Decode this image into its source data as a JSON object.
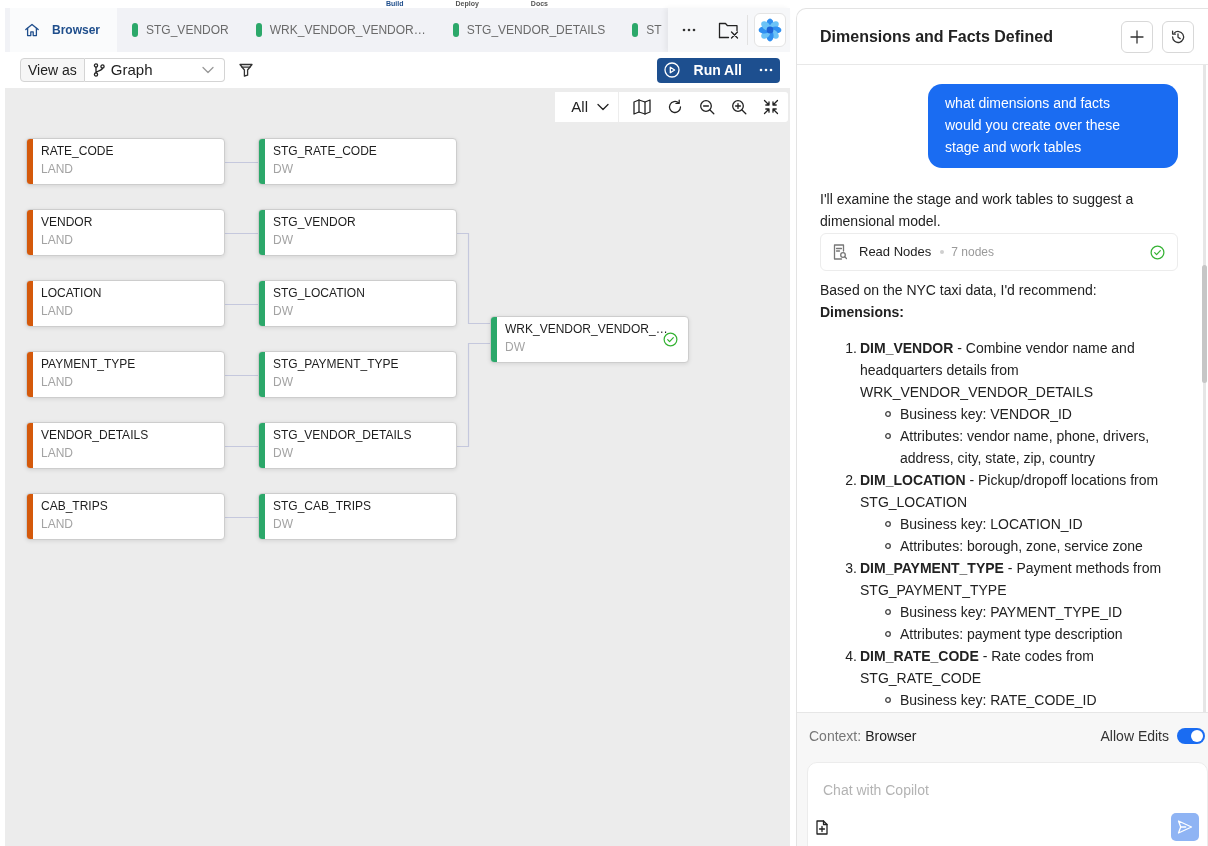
{
  "top_nav": [
    {
      "label": "Build",
      "selected": true
    },
    {
      "label": "Deploy",
      "selected": false
    },
    {
      "label": "Docs",
      "selected": false
    }
  ],
  "tabs": [
    {
      "kind": "home",
      "label": "Browser",
      "selected": true
    },
    {
      "kind": "node",
      "label": "STG_VENDOR",
      "color": "#2ca86a",
      "selected": false
    },
    {
      "kind": "node",
      "label": "WRK_VENDOR_VENDOR…",
      "color": "#2ca86a",
      "selected": false
    },
    {
      "kind": "node",
      "label": "STG_VENDOR_DETAILS",
      "color": "#2ca86a",
      "selected": false
    },
    {
      "kind": "node",
      "label": "ST",
      "color": "#2ca86a",
      "selected": false
    }
  ],
  "toolbar": {
    "view_as_label": "View as",
    "view_mode": "Graph",
    "run_button": "Run All"
  },
  "canvas_controls": {
    "layer_filter": "All"
  },
  "graph": {
    "pairs": [
      {
        "source": {
          "name": "RATE_CODE",
          "layer": "LAND",
          "color": "#d4590b"
        },
        "target": {
          "name": "STG_RATE_CODE",
          "layer": "DW",
          "color": "#2ca86a",
          "feeds_join": false
        }
      },
      {
        "source": {
          "name": "VENDOR",
          "layer": "LAND",
          "color": "#d4590b"
        },
        "target": {
          "name": "STG_VENDOR",
          "layer": "DW",
          "color": "#2ca86a",
          "feeds_join": true
        }
      },
      {
        "source": {
          "name": "LOCATION",
          "layer": "LAND",
          "color": "#d4590b"
        },
        "target": {
          "name": "STG_LOCATION",
          "layer": "DW",
          "color": "#2ca86a",
          "feeds_join": false
        }
      },
      {
        "source": {
          "name": "PAYMENT_TYPE",
          "layer": "LAND",
          "color": "#d4590b"
        },
        "target": {
          "name": "STG_PAYMENT_TYPE",
          "layer": "DW",
          "color": "#2ca86a",
          "feeds_join": false
        }
      },
      {
        "source": {
          "name": "VENDOR_DETAILS",
          "layer": "LAND",
          "color": "#d4590b"
        },
        "target": {
          "name": "STG_VENDOR_DETAILS",
          "layer": "DW",
          "color": "#2ca86a",
          "feeds_join": true
        }
      },
      {
        "source": {
          "name": "CAB_TRIPS",
          "layer": "LAND",
          "color": "#d4590b"
        },
        "target": {
          "name": "STG_CAB_TRIPS",
          "layer": "DW",
          "color": "#2ca86a",
          "feeds_join": false
        }
      }
    ],
    "join": {
      "name": "WRK_VENDOR_VENDOR_…",
      "layer": "DW",
      "color": "#2ca86a",
      "completed": true
    }
  },
  "copilot": {
    "title": "Dimensions and Facts Defined",
    "messages": [
      {
        "kind": "user",
        "text": "what dimensions and facts would you create over these stage and work tables"
      },
      {
        "kind": "assistant",
        "blocks": [
          {
            "kind": "paragraph",
            "text": "I'll examine the stage and work tables to suggest a dimensional model."
          },
          {
            "kind": "tool",
            "label": "Read Nodes",
            "detail": "7 nodes",
            "completed": true
          },
          {
            "kind": "paragraph",
            "text": "Based on the NYC taxi data, I'd recommend:"
          },
          {
            "kind": "heading",
            "text": "Dimensions:"
          },
          {
            "kind": "ordered_list",
            "items": [
              {
                "number": "1.",
                "text": "**DIM_VENDOR** - Combine vendor name and headquarters details from WRK_VENDOR_VENDOR_DETAILS",
                "children": [
                  {
                    "text": "Business key: VENDOR_ID"
                  },
                  {
                    "text": "Attributes: vendor name, phone, drivers, address, city, state, zip, country"
                  }
                ]
              },
              {
                "number": "2.",
                "text": "**DIM_LOCATION** - Pickup/dropoff locations from STG_LOCATION",
                "children": [
                  {
                    "text": "Business key: LOCATION_ID"
                  },
                  {
                    "text": "Attributes: borough, zone, service zone"
                  }
                ]
              },
              {
                "number": "3.",
                "text": "**DIM_PAYMENT_TYPE** - Payment methods from STG_PAYMENT_TYPE",
                "children": [
                  {
                    "text": "Business key: PAYMENT_TYPE_ID"
                  },
                  {
                    "text": "Attributes: payment type description"
                  }
                ]
              },
              {
                "number": "4.",
                "text": "**DIM_RATE_CODE** - Rate codes from STG_RATE_CODE",
                "children": [
                  {
                    "text": "Business key: RATE_CODE_ID"
                  }
                ]
              }
            ]
          }
        ]
      }
    ],
    "context_label": "Context:",
    "context_value": "Browser",
    "allow_edits": {
      "label": "Allow Edits",
      "on": true
    },
    "input": {
      "placeholder": "Chat with Copilot"
    }
  }
}
